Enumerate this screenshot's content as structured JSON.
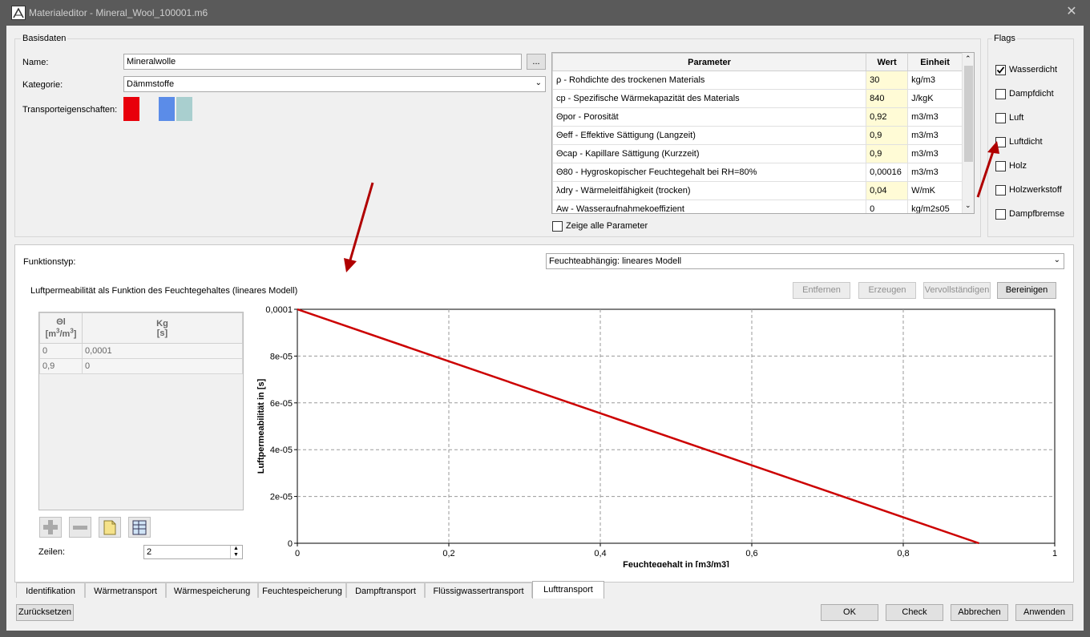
{
  "window": {
    "title": "Materialeditor - Mineral_Wool_100001.m6",
    "close_glyph": "✕"
  },
  "basisdaten": {
    "legend": "Basisdaten",
    "name_label": "Name:",
    "name_value": "Mineralwolle",
    "browse_label": "...",
    "kategorie_label": "Kategorie:",
    "kategorie_value": "Dämmstoffe",
    "transport_label": "Transporteigenschaften:",
    "transport_colors": [
      "#e8000b",
      "#5b8ce8",
      "#a9cfcf"
    ]
  },
  "params": {
    "headers": [
      "Parameter",
      "Wert",
      "Einheit"
    ],
    "rows": [
      {
        "name": "ρ - Rohdichte des trockenen Materials",
        "value": "30",
        "unit": "kg/m3",
        "editable": true
      },
      {
        "name": "cp - Spezifische Wärmekapazität des Materials",
        "value": "840",
        "unit": "J/kgK",
        "editable": true
      },
      {
        "name": "Θpor - Porosität",
        "value": "0,92",
        "unit": "m3/m3",
        "editable": true
      },
      {
        "name": "Θeff - Effektive Sättigung (Langzeit)",
        "value": "0,9",
        "unit": "m3/m3",
        "editable": true
      },
      {
        "name": "Θcap - Kapillare Sättigung (Kurzzeit)",
        "value": "0,9",
        "unit": "m3/m3",
        "editable": true
      },
      {
        "name": "Θ80 - Hygroskopischer Feuchtegehalt bei RH=80%",
        "value": "0,00016",
        "unit": "m3/m3",
        "editable": false
      },
      {
        "name": "λdry - Wärmeleitfähigkeit (trocken)",
        "value": "0,04",
        "unit": "W/mK",
        "editable": true
      },
      {
        "name": "Aw - Wasseraufnahmekoeffizient",
        "value": "0",
        "unit": "kg/m2s05",
        "editable": false
      }
    ],
    "show_all_label": "Zeige alle Parameter"
  },
  "flags": {
    "legend": "Flags",
    "items": [
      {
        "label": "Wasserdicht",
        "checked": true
      },
      {
        "label": "Dampfdicht",
        "checked": false
      },
      {
        "label": "Luft",
        "checked": false
      },
      {
        "label": "Luftdicht",
        "checked": false
      },
      {
        "label": "Holz",
        "checked": false
      },
      {
        "label": "Holzwerkstoff",
        "checked": false
      },
      {
        "label": "Dampfbremse",
        "checked": false
      }
    ]
  },
  "function": {
    "type_label": "Funktionstyp:",
    "type_value": "Feuchteabhängig: lineares Modell",
    "plot_title": "Luftpermeabilität als Funktion des Feuchtegehaltes (lineares Modell)",
    "buttons": [
      {
        "label": "Entfernen",
        "enabled": false
      },
      {
        "label": "Erzeugen",
        "enabled": false
      },
      {
        "label": "Vervollständigen",
        "enabled": false
      },
      {
        "label": "Bereinigen",
        "enabled": true
      }
    ],
    "table_headers": [
      {
        "symbol": "Θl",
        "unit_pre": "[m",
        "sup1": "3",
        "unit_mid": "/m",
        "sup2": "3",
        "unit_post": "]"
      },
      {
        "symbol": "Kg",
        "unit": "[s]"
      }
    ],
    "table_rows": [
      [
        "0",
        "0,0001"
      ],
      [
        "0,9",
        "0"
      ]
    ],
    "rows_label": "Zeilen:",
    "rows_value": "2"
  },
  "chart_data": {
    "type": "line",
    "xlabel": "Feuchtegehalt in [m3/m3]",
    "ylabel": "Luftpermeabilität in [s]",
    "xlim": [
      0,
      1
    ],
    "ylim": [
      0,
      0.0001
    ],
    "x_ticks": [
      "0",
      "0,2",
      "0,4",
      "0,6",
      "0,8",
      "1"
    ],
    "y_ticks": [
      "0",
      "2e-05",
      "4e-05",
      "6e-05",
      "8e-05",
      "0,0001"
    ],
    "grid": true,
    "series": [
      {
        "x": [
          0,
          0.9
        ],
        "y": [
          0.0001,
          0
        ],
        "color": "#cc0000"
      }
    ]
  },
  "tabs": [
    {
      "label": "Identifikation",
      "active": false
    },
    {
      "label": "Wärmetransport",
      "active": false
    },
    {
      "label": "Wärmespeicherung",
      "active": false
    },
    {
      "label": "Feuchtespeicherung",
      "active": false
    },
    {
      "label": "Dampftransport",
      "active": false
    },
    {
      "label": "Flüssigwassertransport",
      "active": false
    },
    {
      "label": "Lufttransport",
      "active": true
    }
  ],
  "footer": {
    "reset_label": "Zurücksetzen",
    "ok_label": "OK",
    "check_label": "Check",
    "cancel_label": "Abbrechen",
    "apply_label": "Anwenden"
  },
  "annotation_color": "#b00000"
}
